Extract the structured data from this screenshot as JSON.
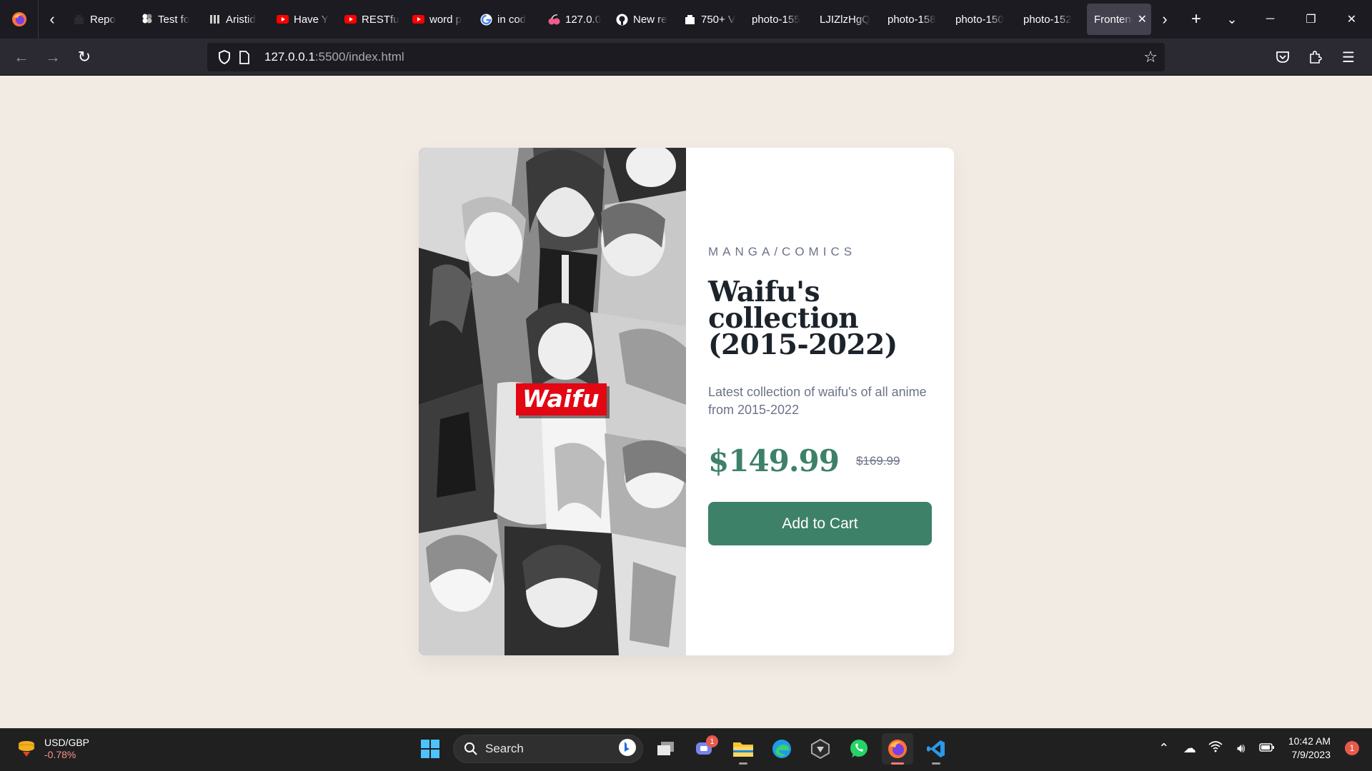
{
  "browser": {
    "tabs": [
      {
        "label": "Repo",
        "favicon": "dark-square-icon",
        "color": "#2b2a33"
      },
      {
        "label": "Test fo",
        "favicon": "figma-icon",
        "color": "#ffffff"
      },
      {
        "label": "Aristid",
        "favicon": "bars-icon",
        "color": "#cfcfcf"
      },
      {
        "label": "Have Y",
        "favicon": "youtube-icon",
        "color": "#ff0000"
      },
      {
        "label": "RESTfu",
        "favicon": "youtube-icon",
        "color": "#ff0000"
      },
      {
        "label": "word p",
        "favicon": "youtube-icon",
        "color": "#ff0000"
      },
      {
        "label": "in cod",
        "favicon": "google-icon",
        "color": "#ffffff"
      },
      {
        "label": "127.0.0",
        "favicon": "cherry-icon",
        "color": "#f15b8c"
      },
      {
        "label": "New re",
        "favicon": "github-icon",
        "color": "#ffffff"
      },
      {
        "label": "750+ V",
        "favicon": "dark-square-icon",
        "color": "#ffffff"
      },
      {
        "label": "photo-155",
        "favicon": "none",
        "color": ""
      },
      {
        "label": "LJIZlzHgQ",
        "favicon": "none",
        "color": ""
      },
      {
        "label": "photo-158",
        "favicon": "none",
        "color": ""
      },
      {
        "label": "photo-150",
        "favicon": "none",
        "color": ""
      },
      {
        "label": "photo-152",
        "favicon": "none",
        "color": ""
      }
    ],
    "active_tab": {
      "label": "Frontend"
    },
    "url_host": "127.0.0.1",
    "url_rest": ":5500/index.html"
  },
  "product": {
    "image_label": "Waifu",
    "category": "MANGA/COMICS",
    "title": "Waifu's collection (2015-2022)",
    "description": "Latest collection of waifu's of all anime from 2015-2022",
    "price": "$149.99",
    "old_price": "$169.99",
    "cta": "Add to Cart",
    "colors": {
      "accent": "#3d8168",
      "background": "#f2ebe4",
      "heading": "#1c232b",
      "muted": "#6c7289"
    }
  },
  "taskbar": {
    "widget_title": "USD/GBP",
    "widget_change": "-0.78%",
    "search_label": "Search",
    "teams_badge": "1",
    "time": "10:42 AM",
    "date": "7/9/2023",
    "notification_count": "1"
  }
}
